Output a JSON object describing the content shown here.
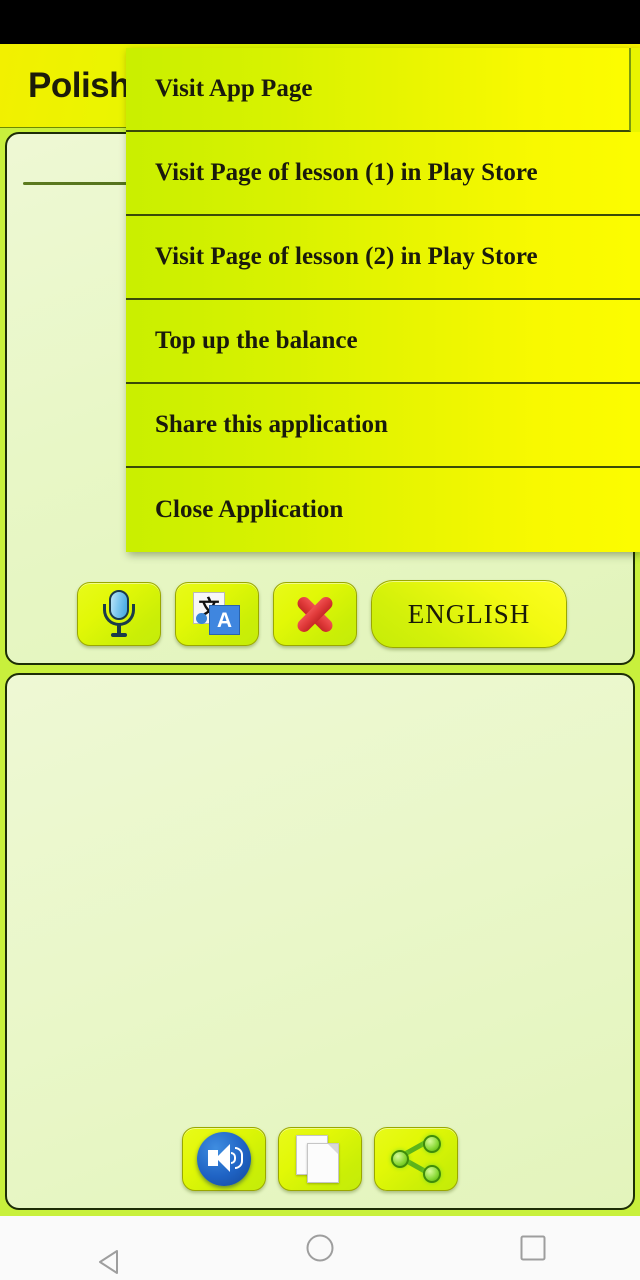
{
  "app": {
    "title": "Polish",
    "status_bar_color": "#000000",
    "app_bar_accent": "#eaf500",
    "panel_bg": "#e9f7c8",
    "page_bg": "#c8f03c"
  },
  "input_panel": {
    "name": "source-text-panel",
    "text": "",
    "placeholder": "",
    "buttons": [
      {
        "name": "voice-input-button",
        "icon": "microphone-icon",
        "label": ""
      },
      {
        "name": "translate-button",
        "icon": "translate-icon",
        "label": ""
      },
      {
        "name": "clear-text-button",
        "icon": "red-x-icon",
        "label": ""
      },
      {
        "name": "language-button",
        "icon": "",
        "label": "ENGLISH"
      }
    ]
  },
  "output_panel": {
    "name": "translated-text-panel",
    "text": "",
    "buttons": [
      {
        "name": "speak-button",
        "icon": "speaker-icon",
        "label": ""
      },
      {
        "name": "copy-button",
        "icon": "copy-icon",
        "label": ""
      },
      {
        "name": "share-button",
        "icon": "share-icon",
        "label": ""
      }
    ]
  },
  "popup_menu": {
    "visible": true,
    "items": [
      {
        "label": "Visit App Page"
      },
      {
        "label": "Visit Page of lesson (1) in Play Store"
      },
      {
        "label": "Visit Page of lesson (2) in Play Store"
      },
      {
        "label": "Top up the balance"
      },
      {
        "label": "Share this application"
      },
      {
        "label": "Close Application"
      }
    ]
  },
  "nav_bar": {
    "back": "back-triangle-icon",
    "home": "home-circle-icon",
    "recents": "recents-square-icon"
  }
}
